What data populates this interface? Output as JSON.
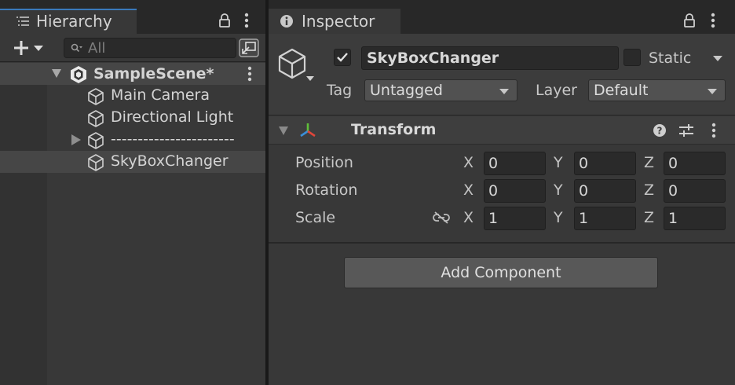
{
  "hierarchy": {
    "tab_label": "Hierarchy",
    "search_placeholder": "All",
    "scene_name": "SampleScene*",
    "items": [
      {
        "label": "Main Camera"
      },
      {
        "label": "Directional Light"
      },
      {
        "label": "-----------------------"
      },
      {
        "label": "SkyBoxChanger"
      }
    ]
  },
  "inspector": {
    "tab_label": "Inspector",
    "object_name": "SkyBoxChanger",
    "active": true,
    "static_label": "Static",
    "tag_label": "Tag",
    "tag_value": "Untagged",
    "layer_label": "Layer",
    "layer_value": "Default",
    "transform": {
      "title": "Transform",
      "position": {
        "label": "Position",
        "x": "0",
        "y": "0",
        "z": "0"
      },
      "rotation": {
        "label": "Rotation",
        "x": "0",
        "y": "0",
        "z": "0"
      },
      "scale": {
        "label": "Scale",
        "x": "1",
        "y": "1",
        "z": "1"
      },
      "axis_x": "X",
      "axis_y": "Y",
      "axis_z": "Z"
    },
    "add_component_label": "Add Component"
  },
  "colors": {
    "panel_bg": "#383838",
    "tab_bar_bg": "#282828",
    "field_bg": "#2a2a2a",
    "selection": "#464646",
    "accent": "#3a79bb"
  },
  "icons": [
    "hierarchy-list-icon",
    "lock-icon",
    "kebab-menu-icon",
    "plus-icon",
    "search-icon",
    "toggle-view-icon",
    "unity-scene-icon",
    "gameobject-cube-icon",
    "info-icon",
    "help-icon",
    "presets-icon",
    "transform-axes-icon",
    "constrain-proportions-icon"
  ]
}
